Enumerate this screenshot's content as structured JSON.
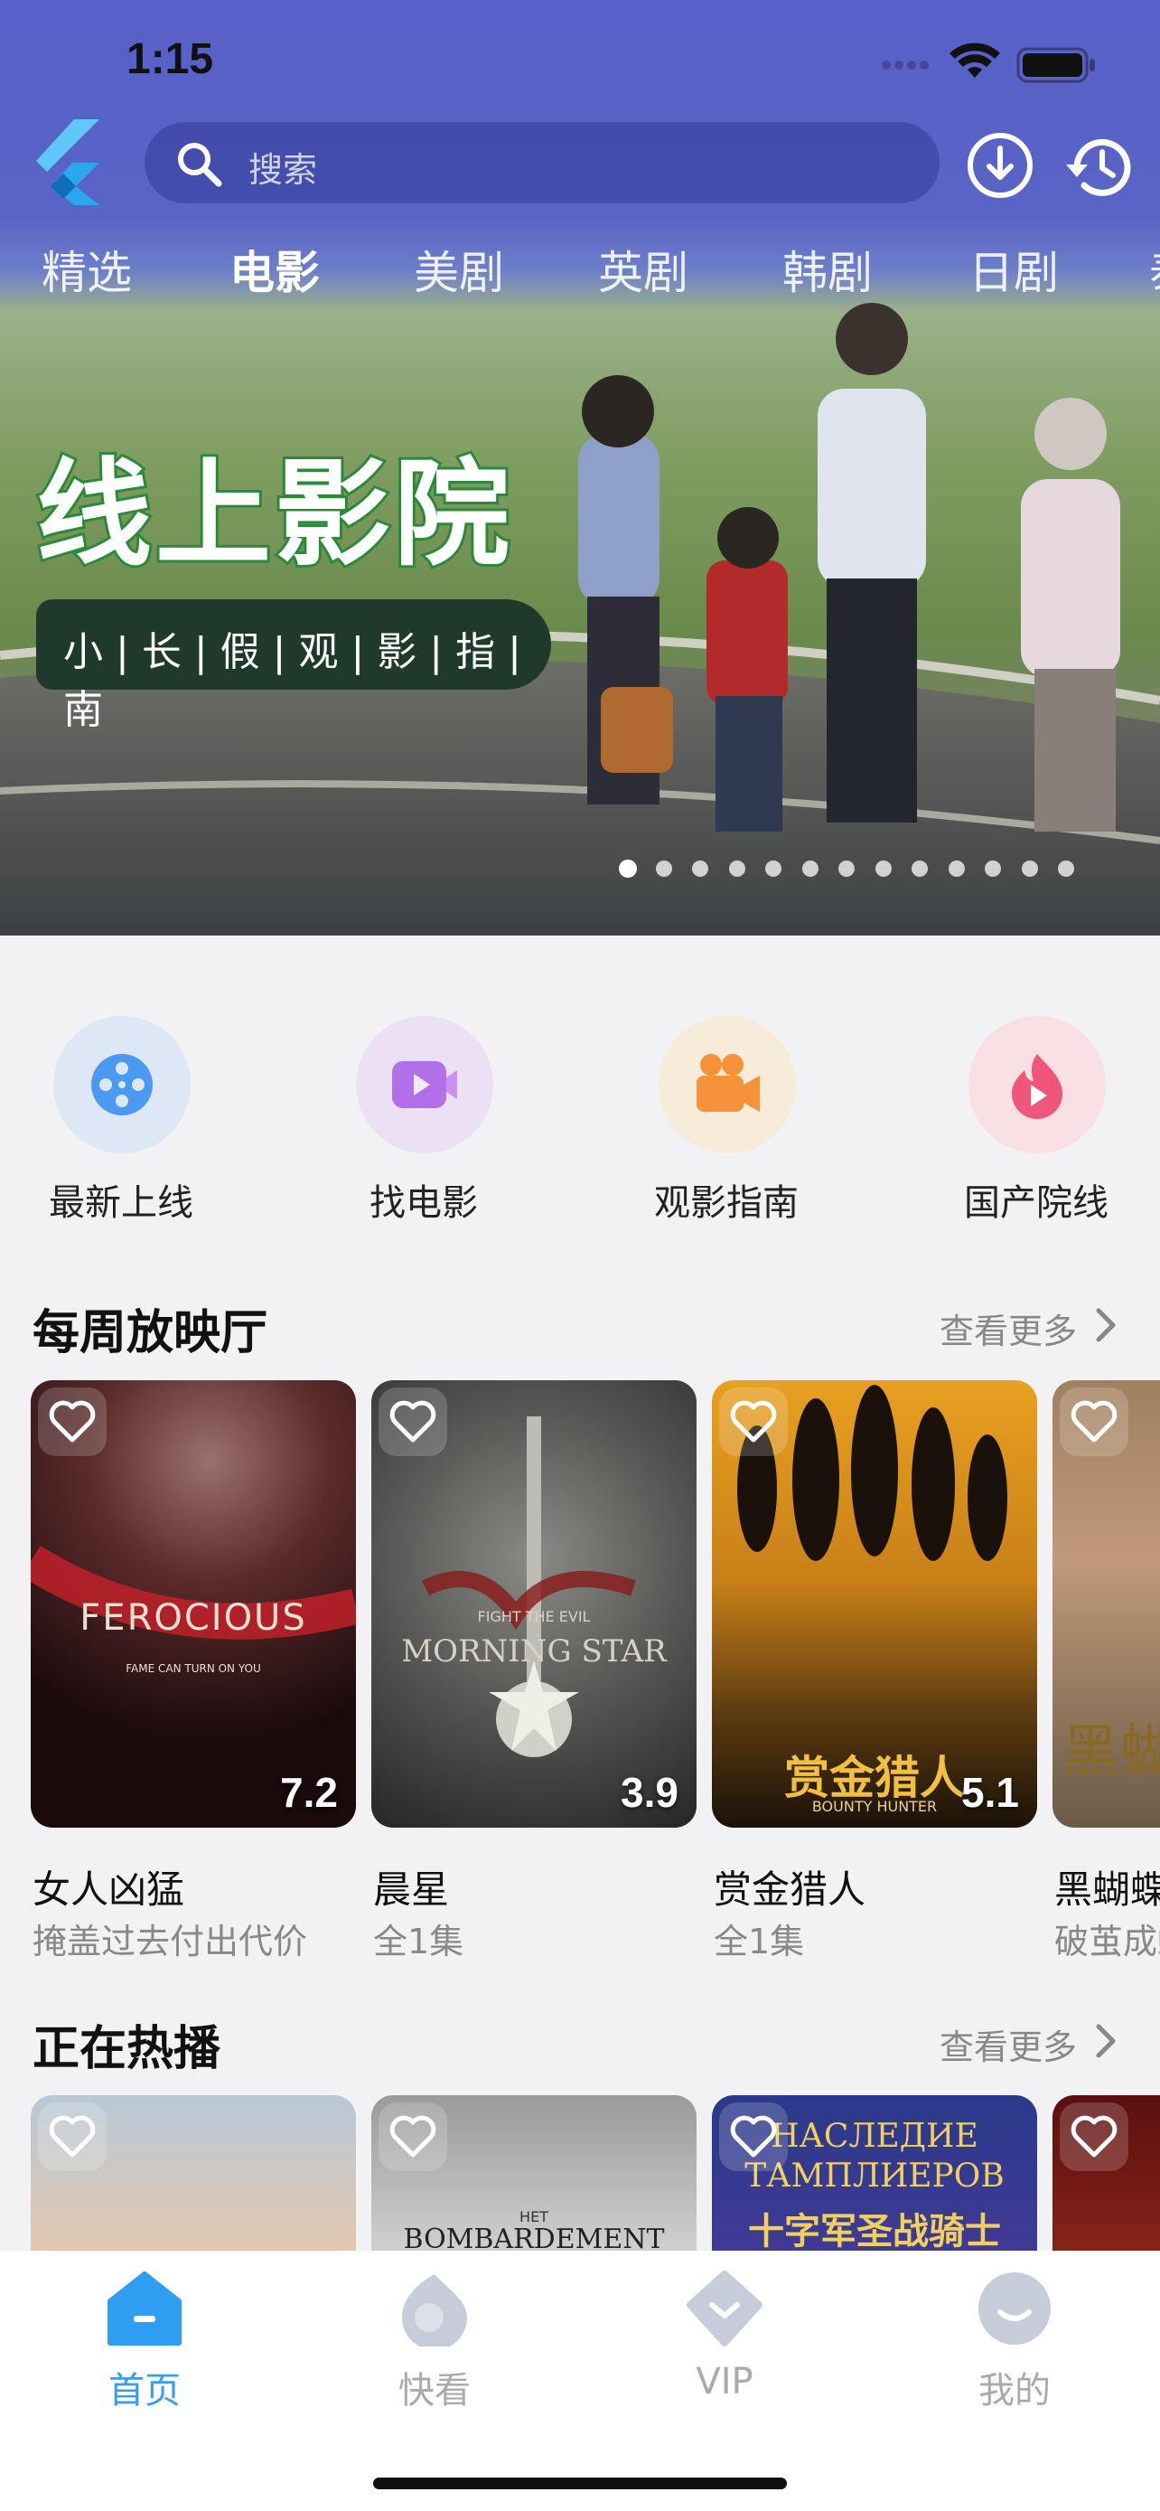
{
  "status_bar": {
    "time": "1:15"
  },
  "search": {
    "placeholder": "搜索"
  },
  "category_tabs": [
    {
      "label": "精选",
      "active": false
    },
    {
      "label": "电影",
      "active": true
    },
    {
      "label": "美剧",
      "active": false
    },
    {
      "label": "英剧",
      "active": false
    },
    {
      "label": "韩剧",
      "active": false
    },
    {
      "label": "日剧",
      "active": false
    },
    {
      "label": "泰",
      "active": false
    }
  ],
  "banner": {
    "title": "线上影院",
    "subtitle": "小|长|假|观|影|指|南",
    "page_count": 13,
    "active_page": 0
  },
  "quick_access": [
    {
      "label": "最新上线",
      "icon": "film-reel-icon",
      "color": "#dde7f5",
      "icon_color": "#4a9af2"
    },
    {
      "label": "找电影",
      "icon": "video-play-icon",
      "color": "#ece0f5",
      "icon_color": "#b170e8"
    },
    {
      "label": "观影指南",
      "icon": "movie-camera-icon",
      "color": "#f7ebd9",
      "icon_color": "#f6923a"
    },
    {
      "label": "国产院线",
      "icon": "flame-play-icon",
      "color": "#f7dfe4",
      "icon_color": "#f0557c"
    }
  ],
  "weekly": {
    "title": "每周放映厅",
    "more": "查看更多",
    "items": [
      {
        "title": "女人凶猛",
        "subtitle": "掩盖过去付出代价",
        "score": "7.2",
        "poster_text": "FEROCIOUS",
        "poster_tagline": "FAME CAN TURN ON YOU"
      },
      {
        "title": "晨星",
        "subtitle": "全1集",
        "score": "3.9",
        "poster_text": "MORNING STAR",
        "poster_tagline": "FIGHT THE EVIL"
      },
      {
        "title": "赏金猎人",
        "subtitle": "全1集",
        "score": "5.1",
        "poster_text": "赏金猎人",
        "poster_tagline": "BOUNTY HUNTER"
      },
      {
        "title": "黑蝴蝶",
        "subtitle": "破茧成蝶",
        "score": "",
        "poster_text": "黑蝴",
        "poster_tagline": ""
      }
    ]
  },
  "hot": {
    "title": "正在热播",
    "more": "查看更多",
    "items": [
      {
        "poster_text": ""
      },
      {
        "poster_text": "BOMBARDEMENT",
        "poster_tagline": "HET"
      },
      {
        "poster_text": "НАСЛЕДИЕ ТАМПЛИЕРОВ",
        "poster_tagline": "十字军圣战骑士"
      },
      {
        "poster_text": ""
      }
    ]
  },
  "tab_bar": [
    {
      "label": "首页",
      "icon": "home-icon",
      "active": true
    },
    {
      "label": "快看",
      "icon": "play-flame-icon",
      "active": false
    },
    {
      "label": "VIP",
      "icon": "vip-diamond-icon",
      "active": false
    },
    {
      "label": "我的",
      "icon": "profile-face-icon",
      "active": false
    }
  ]
}
